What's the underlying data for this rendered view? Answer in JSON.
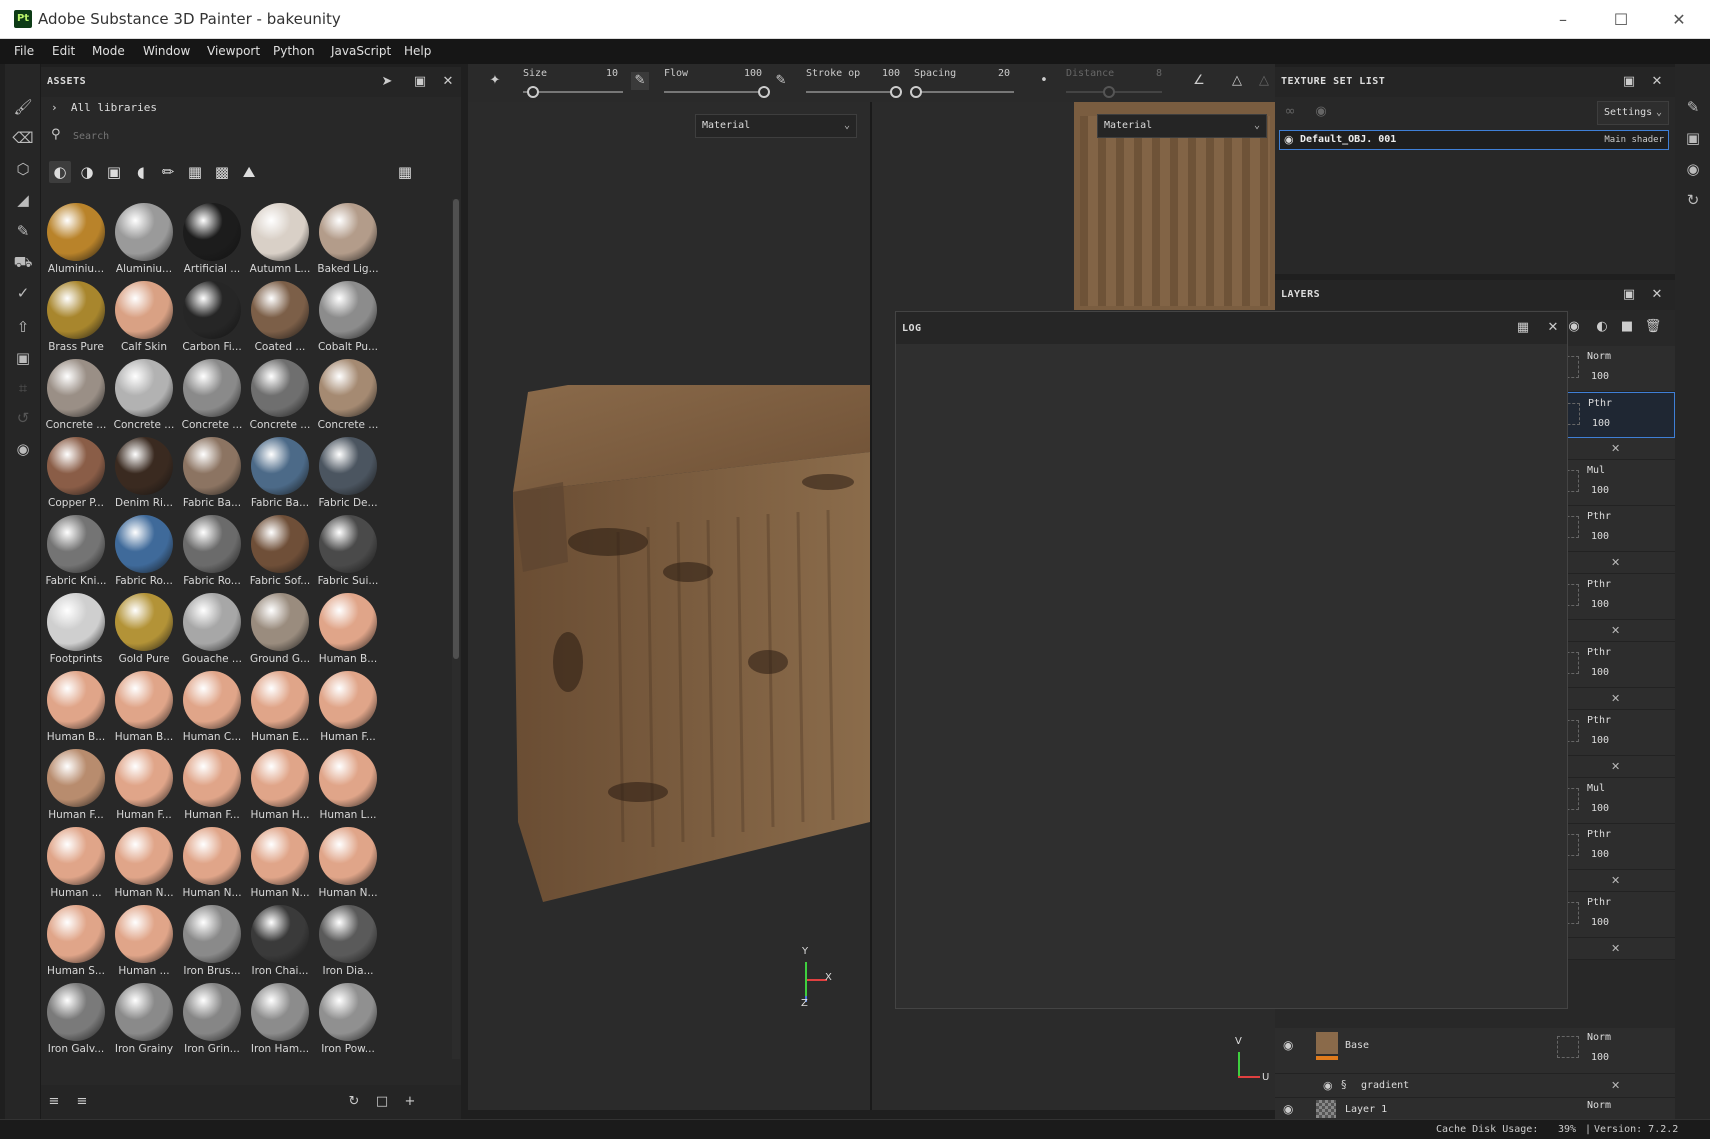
{
  "window": {
    "title": "Adobe Substance 3D Painter - bakeunity",
    "icon_text": "Pt"
  },
  "menu": [
    "File",
    "Edit",
    "Mode",
    "Window",
    "Viewport",
    "Python",
    "JavaScript",
    "Help"
  ],
  "assets": {
    "title": "ASSETS",
    "breadcrumb": "All libraries",
    "search_placeholder": "Search",
    "items": [
      {
        "label": "Aluminiu...",
        "color": "#b9832a"
      },
      {
        "label": "Aluminiu...",
        "color": "#9a9a9a"
      },
      {
        "label": "Artificial ...",
        "color": "#1c1c1c"
      },
      {
        "label": "Autumn L...",
        "color": "#d9d0c7"
      },
      {
        "label": "Baked Lig...",
        "color": "#b39c8a"
      },
      {
        "label": "Brass Pure",
        "color": "#a8862d"
      },
      {
        "label": "Calf Skin",
        "color": "#d9a184"
      },
      {
        "label": "Carbon Fi...",
        "color": "#262626"
      },
      {
        "label": "Coated ...",
        "color": "#7c5f48"
      },
      {
        "label": "Cobalt Pu...",
        "color": "#8c8c8c"
      },
      {
        "label": "Concrete ...",
        "color": "#9a8f86"
      },
      {
        "label": "Concrete ...",
        "color": "#b2b2b2"
      },
      {
        "label": "Concrete ...",
        "color": "#8a8a8a"
      },
      {
        "label": "Concrete ...",
        "color": "#6f6f6f"
      },
      {
        "label": "Concrete ...",
        "color": "#a58a72"
      },
      {
        "label": "Copper P...",
        "color": "#8a5d47"
      },
      {
        "label": "Denim Ri...",
        "color": "#3a2a20"
      },
      {
        "label": "Fabric Ba...",
        "color": "#8c7462"
      },
      {
        "label": "Fabric Ba...",
        "color": "#4c6a88"
      },
      {
        "label": "Fabric De...",
        "color": "#4b5560"
      },
      {
        "label": "Fabric Kni...",
        "color": "#747474"
      },
      {
        "label": "Fabric Ro...",
        "color": "#3f6a9a"
      },
      {
        "label": "Fabric Ro...",
        "color": "#6b6b6b"
      },
      {
        "label": "Fabric Sof...",
        "color": "#6f4f38"
      },
      {
        "label": "Fabric Sui...",
        "color": "#4a4a4a"
      },
      {
        "label": "Footprints",
        "color": "#cfcfcf"
      },
      {
        "label": "Gold Pure",
        "color": "#b39337"
      },
      {
        "label": "Gouache ...",
        "color": "#a7a7a7"
      },
      {
        "label": "Ground G...",
        "color": "#9a8c7e"
      },
      {
        "label": "Human B...",
        "color": "#e0a589"
      },
      {
        "label": "Human B...",
        "color": "#e0a589"
      },
      {
        "label": "Human B...",
        "color": "#e0a589"
      },
      {
        "label": "Human C...",
        "color": "#e0a589"
      },
      {
        "label": "Human E...",
        "color": "#e0a589"
      },
      {
        "label": "Human F...",
        "color": "#e0a589"
      },
      {
        "label": "Human F...",
        "color": "#b88c6e"
      },
      {
        "label": "Human F...",
        "color": "#e0a589"
      },
      {
        "label": "Human F...",
        "color": "#e0a589"
      },
      {
        "label": "Human H...",
        "color": "#e0a589"
      },
      {
        "label": "Human L...",
        "color": "#e0a589"
      },
      {
        "label": "Human ...",
        "color": "#e0a589"
      },
      {
        "label": "Human N...",
        "color": "#e0a589"
      },
      {
        "label": "Human N...",
        "color": "#e0a589"
      },
      {
        "label": "Human N...",
        "color": "#e0a589"
      },
      {
        "label": "Human N...",
        "color": "#e0a589"
      },
      {
        "label": "Human S...",
        "color": "#e0a589"
      },
      {
        "label": "Human ...",
        "color": "#e0a589"
      },
      {
        "label": "Iron Brus...",
        "color": "#8a8a8a"
      },
      {
        "label": "Iron Chai...",
        "color": "#3a3a3a"
      },
      {
        "label": "Iron Dia...",
        "color": "#5a5a5a"
      },
      {
        "label": "Iron Galv...",
        "color": "#7a7a7a"
      },
      {
        "label": "Iron Grainy",
        "color": "#8a8a8a"
      },
      {
        "label": "Iron Grin...",
        "color": "#868686"
      },
      {
        "label": "Iron Ham...",
        "color": "#8c8c8c"
      },
      {
        "label": "Iron Pow...",
        "color": "#909090"
      },
      {
        "label": "",
        "color": "#808080"
      },
      {
        "label": "",
        "color": "#808080"
      },
      {
        "label": "",
        "color": "#808080"
      },
      {
        "label": "",
        "color": "#808080"
      },
      {
        "label": "",
        "color": "#808080"
      }
    ]
  },
  "toolbar": {
    "size_label": "Size",
    "size_value": "10",
    "size_fraction": 0.1,
    "flow_label": "Flow",
    "flow_value": "100",
    "flow_fraction": 1.0,
    "stroke_label": "Stroke op",
    "stroke_value": "100",
    "stroke_fraction": 1.0,
    "spacing_label": "Spacing",
    "spacing_value": "20",
    "spacing_fraction": 0.02,
    "distance_label": "Distance",
    "distance_value": "8"
  },
  "viewport": {
    "left_channel": "Material",
    "right_channel": "Material",
    "axis_y": "Y",
    "axis_x": "X",
    "axis_z": "Z",
    "axis_v": "V",
    "axis_u": "U"
  },
  "texture_set_list": {
    "title": "TEXTURE SET LIST",
    "settings_label": "Settings",
    "set_name": "Default_OBJ. 001",
    "shader": "Main shader"
  },
  "layers": {
    "title": "LAYERS",
    "rows": [
      {
        "kind": "layer",
        "blend": "Norm",
        "opacity": "100"
      },
      {
        "kind": "layer",
        "blend": "Pthr",
        "opacity": "100"
      },
      {
        "kind": "effect"
      },
      {
        "kind": "layer",
        "blend": "Mul",
        "opacity": "100"
      },
      {
        "kind": "layer",
        "blend": "Pthr",
        "opacity": "100"
      },
      {
        "kind": "effect"
      },
      {
        "kind": "layer",
        "blend": "Pthr",
        "opacity": "100"
      },
      {
        "kind": "effect"
      },
      {
        "kind": "layer",
        "blend": "Pthr",
        "opacity": "100"
      },
      {
        "kind": "effect"
      },
      {
        "kind": "layer",
        "blend": "Pthr",
        "opacity": "100"
      },
      {
        "kind": "effect"
      },
      {
        "kind": "layer",
        "blend": "Mul",
        "opacity": "100"
      },
      {
        "kind": "layer",
        "blend": "Pthr",
        "opacity": "100"
      },
      {
        "kind": "effect"
      },
      {
        "kind": "layer",
        "blend": "Pthr",
        "opacity": "100"
      },
      {
        "kind": "effect"
      }
    ],
    "base_name": "Base",
    "base_blend": "Norm",
    "base_opacity": "100",
    "gradient_name": "gradient",
    "layer1_name": "Layer 1",
    "layer1_blend": "Norm",
    "layer1_opacity": "100"
  },
  "log": {
    "title": "LOG"
  },
  "status": {
    "cache_label": "Cache Disk Usage:",
    "cache_value": "39%",
    "version": "Version: 7.2.2"
  }
}
